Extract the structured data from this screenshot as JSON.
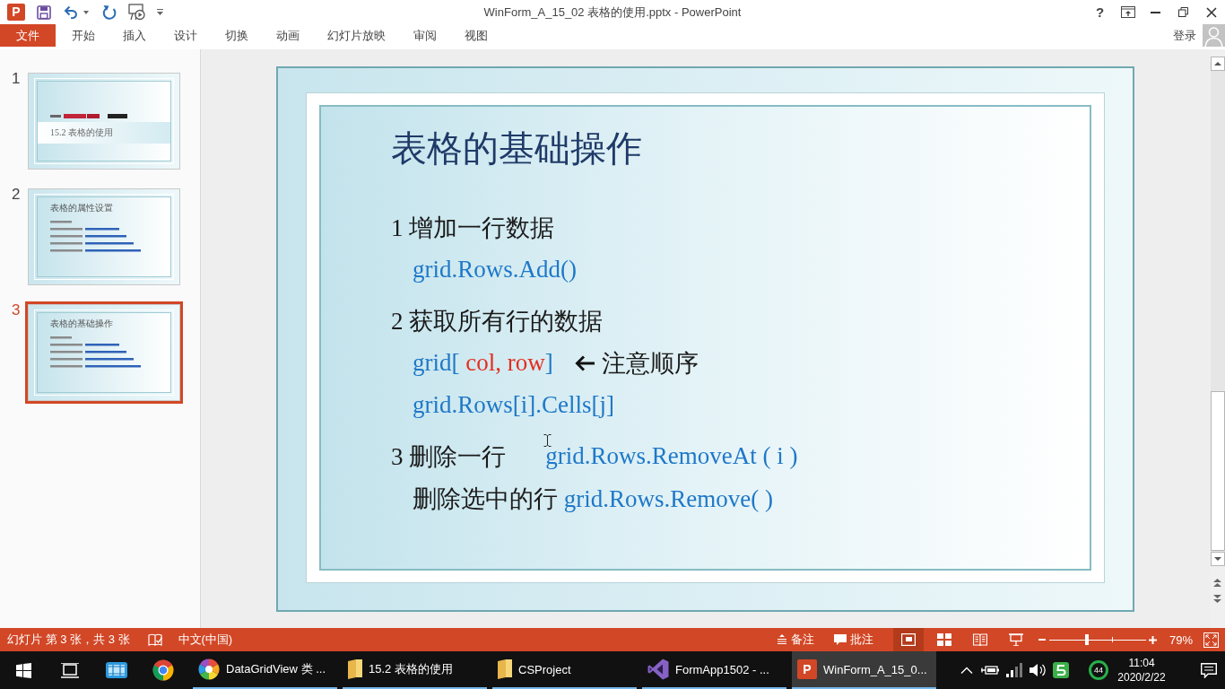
{
  "window": {
    "logo_letter": "P",
    "title": "WinForm_A_15_02 表格的使用.pptx - PowerPoint",
    "help_button": "?"
  },
  "ribbon": {
    "file_tab": "文件",
    "tabs": [
      "开始",
      "插入",
      "设计",
      "切换",
      "动画",
      "幻灯片放映",
      "审阅",
      "视图"
    ],
    "sign_in": "登录"
  },
  "thumbnails": [
    {
      "number": "1",
      "kind": "title",
      "selected": false,
      "title": "15.2 表格的使用"
    },
    {
      "number": "2",
      "kind": "content",
      "selected": false,
      "title": "表格的属性设置"
    },
    {
      "number": "3",
      "kind": "content",
      "selected": true,
      "title": "表格的基础操作"
    }
  ],
  "slide": {
    "title": "表格的基础操作",
    "groups": [
      {
        "heading": {
          "runs": [
            {
              "kind": "plain",
              "text": "1 增加一行数据"
            }
          ]
        },
        "children": [
          {
            "runs": [
              {
                "kind": "code",
                "text": "grid.Rows.Add()"
              }
            ]
          }
        ]
      },
      {
        "heading": {
          "runs": [
            {
              "kind": "plain",
              "text": "2 获取所有行的数据"
            }
          ]
        },
        "children": [
          {
            "runs": [
              {
                "kind": "code",
                "text": "grid["
              },
              {
                "kind": "emphasis",
                "text": " col, row"
              },
              {
                "kind": "code",
                "text": "]"
              }
            ],
            "note": "注意顺序"
          },
          {
            "runs": [
              {
                "kind": "code",
                "text": "grid.Rows[i].Cells[j]"
              }
            ]
          }
        ]
      },
      {
        "heading": {
          "runs": [
            {
              "kind": "plain",
              "text": "3 删除一行"
            }
          ],
          "code": "grid.Rows.RemoveAt ( i )"
        },
        "children": [
          {
            "runs": [
              {
                "kind": "plain",
                "text": "删除选中的行 "
              },
              {
                "kind": "code",
                "text": "grid.Rows.Remove( )"
              }
            ]
          }
        ]
      }
    ]
  },
  "status_bar": {
    "slide_info": "幻灯片 第 3 张，共 3 张",
    "language": "中文(中国)",
    "notes": "备注",
    "comments": "批注",
    "views": [
      {
        "kind": "normal",
        "selected": true
      },
      {
        "kind": "sorter",
        "selected": false
      },
      {
        "kind": "reading",
        "selected": false
      },
      {
        "kind": "slideshow",
        "selected": false
      }
    ],
    "zoom": {
      "level": 0.39,
      "reading": "79%"
    }
  },
  "taskbar": {
    "tasks": [
      {
        "kind": "browser",
        "label": "DataGridView 类 ...",
        "selected": false
      },
      {
        "kind": "folder",
        "label": "15.2 表格的使用",
        "selected": false
      },
      {
        "kind": "folder",
        "label": "CSProject",
        "selected": false
      },
      {
        "kind": "ide",
        "label": "FormApp1502 - ...",
        "selected": false
      },
      {
        "kind": "presentation",
        "label": "WinForm_A_15_0...",
        "selected": true,
        "icon_letter": "P"
      }
    ],
    "tray_badge": "44",
    "clock": {
      "time": "11:04",
      "date": "2020/2/22"
    }
  }
}
